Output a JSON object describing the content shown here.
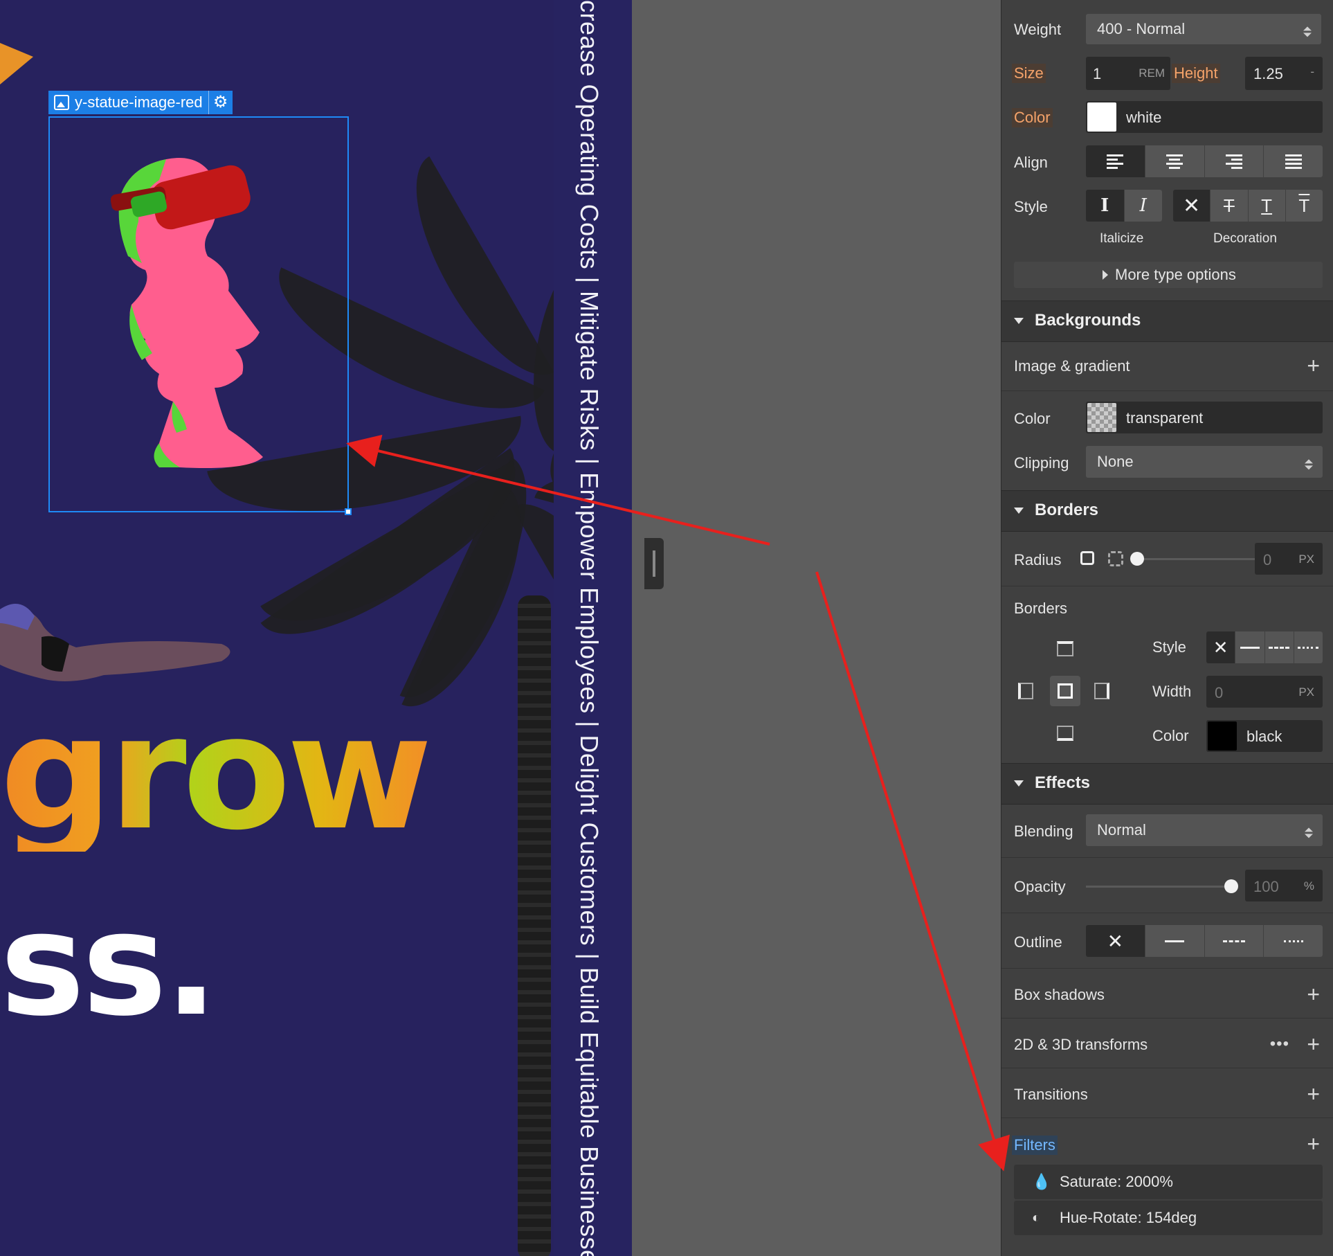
{
  "canvas": {
    "selected_element_name": "y-statue-image-red",
    "vertical_text": "crease Operating Costs  |  Mitigate Risks  |  Empower Employees  |  Delight Customers  |  Build Equitable Businesses R",
    "headline_word": "grow",
    "headline_word_2": "ss."
  },
  "typography": {
    "weight_label": "Weight",
    "weight_value": "400 - Normal",
    "size_label": "Size",
    "size_value": "1",
    "size_unit": "REM",
    "height_label": "Height",
    "height_value": "1.25",
    "height_unit": "-",
    "color_label": "Color",
    "color_value": "white",
    "align_label": "Align",
    "style_label": "Style",
    "italicize_label": "Italicize",
    "decoration_label": "Decoration",
    "more_type_options": "More type options"
  },
  "backgrounds": {
    "title": "Backgrounds",
    "image_gradient_label": "Image & gradient",
    "color_label": "Color",
    "color_value": "transparent",
    "clipping_label": "Clipping",
    "clipping_value": "None"
  },
  "borders": {
    "title": "Borders",
    "radius_label": "Radius",
    "radius_value": "0",
    "radius_unit": "PX",
    "borders_label": "Borders",
    "style_label": "Style",
    "width_label": "Width",
    "width_value": "0",
    "width_unit": "PX",
    "color_label": "Color",
    "color_value": "black"
  },
  "effects": {
    "title": "Effects",
    "blending_label": "Blending",
    "blending_value": "Normal",
    "opacity_label": "Opacity",
    "opacity_value": "100",
    "opacity_unit": "%",
    "outline_label": "Outline",
    "box_shadows_label": "Box shadows",
    "transforms_label": "2D & 3D transforms",
    "transitions_label": "Transitions",
    "filters_label": "Filters",
    "filters": [
      {
        "icon": "drop-icon",
        "label": "Saturate: 2000%"
      },
      {
        "icon": "eye-icon",
        "label": "Hue-Rotate: 154deg"
      }
    ]
  },
  "colors": {
    "canvas_bg": "#27225e",
    "panel_bg": "#404040",
    "selection_blue": "#1e8af7",
    "annotation_red": "#e8201d",
    "active_orange": "#f5a36a",
    "active_blue": "#74b8ff"
  }
}
